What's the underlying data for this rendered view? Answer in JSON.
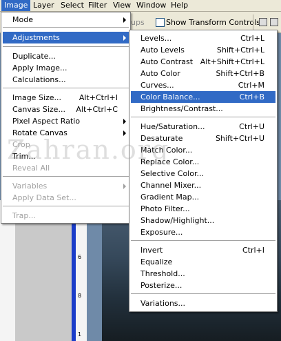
{
  "menubar": {
    "items": [
      "Image",
      "Layer",
      "Select",
      "Filter",
      "View",
      "Window",
      "Help"
    ],
    "active": "Image"
  },
  "options_bar": {
    "partial_label": "ups",
    "show_transform_controls": "Show Transform Controls",
    "show_transform_checked": false
  },
  "image_menu": {
    "items": [
      {
        "label": "Mode",
        "submenu": true
      },
      {
        "label": "Adjustments",
        "submenu": true,
        "highlighted": true
      },
      {
        "label": "Duplicate..."
      },
      {
        "label": "Apply Image..."
      },
      {
        "label": "Calculations..."
      },
      {
        "label": "Image Size...",
        "shortcut": "Alt+Ctrl+I"
      },
      {
        "label": "Canvas Size...",
        "shortcut": "Alt+Ctrl+C"
      },
      {
        "label": "Pixel Aspect Ratio",
        "submenu": true
      },
      {
        "label": "Rotate Canvas",
        "submenu": true
      },
      {
        "label": "Crop",
        "disabled": true
      },
      {
        "label": "Trim..."
      },
      {
        "label": "Reveal All",
        "disabled": true
      },
      {
        "label": "Variables",
        "submenu": true,
        "disabled": true
      },
      {
        "label": "Apply Data Set...",
        "disabled": true
      },
      {
        "label": "Trap...",
        "disabled": true
      }
    ]
  },
  "adjustments_menu": {
    "items": [
      {
        "label": "Levels...",
        "shortcut": "Ctrl+L"
      },
      {
        "label": "Auto Levels",
        "shortcut": "Shift+Ctrl+L"
      },
      {
        "label": "Auto Contrast",
        "shortcut": "Alt+Shift+Ctrl+L"
      },
      {
        "label": "Auto Color",
        "shortcut": "Shift+Ctrl+B"
      },
      {
        "label": "Curves...",
        "shortcut": "Ctrl+M"
      },
      {
        "label": "Color Balance...",
        "shortcut": "Ctrl+B",
        "highlighted": true
      },
      {
        "label": "Brightness/Contrast..."
      },
      {
        "label": "Hue/Saturation...",
        "shortcut": "Ctrl+U"
      },
      {
        "label": "Desaturate",
        "shortcut": "Shift+Ctrl+U"
      },
      {
        "label": "Match Color..."
      },
      {
        "label": "Replace Color..."
      },
      {
        "label": "Selective Color..."
      },
      {
        "label": "Channel Mixer..."
      },
      {
        "label": "Gradient Map..."
      },
      {
        "label": "Photo Filter..."
      },
      {
        "label": "Shadow/Highlight..."
      },
      {
        "label": "Exposure..."
      },
      {
        "label": "Invert",
        "shortcut": "Ctrl+I"
      },
      {
        "label": "Equalize"
      },
      {
        "label": "Threshold..."
      },
      {
        "label": "Posterize..."
      },
      {
        "label": "Variations..."
      }
    ]
  },
  "watermark": "Zahran.org",
  "ruler_numbers": [
    "6",
    "8",
    "1"
  ],
  "colors": {
    "highlight": "#316ac5",
    "menubar": "#ece9d8",
    "disabled": "#a0a0a0"
  }
}
